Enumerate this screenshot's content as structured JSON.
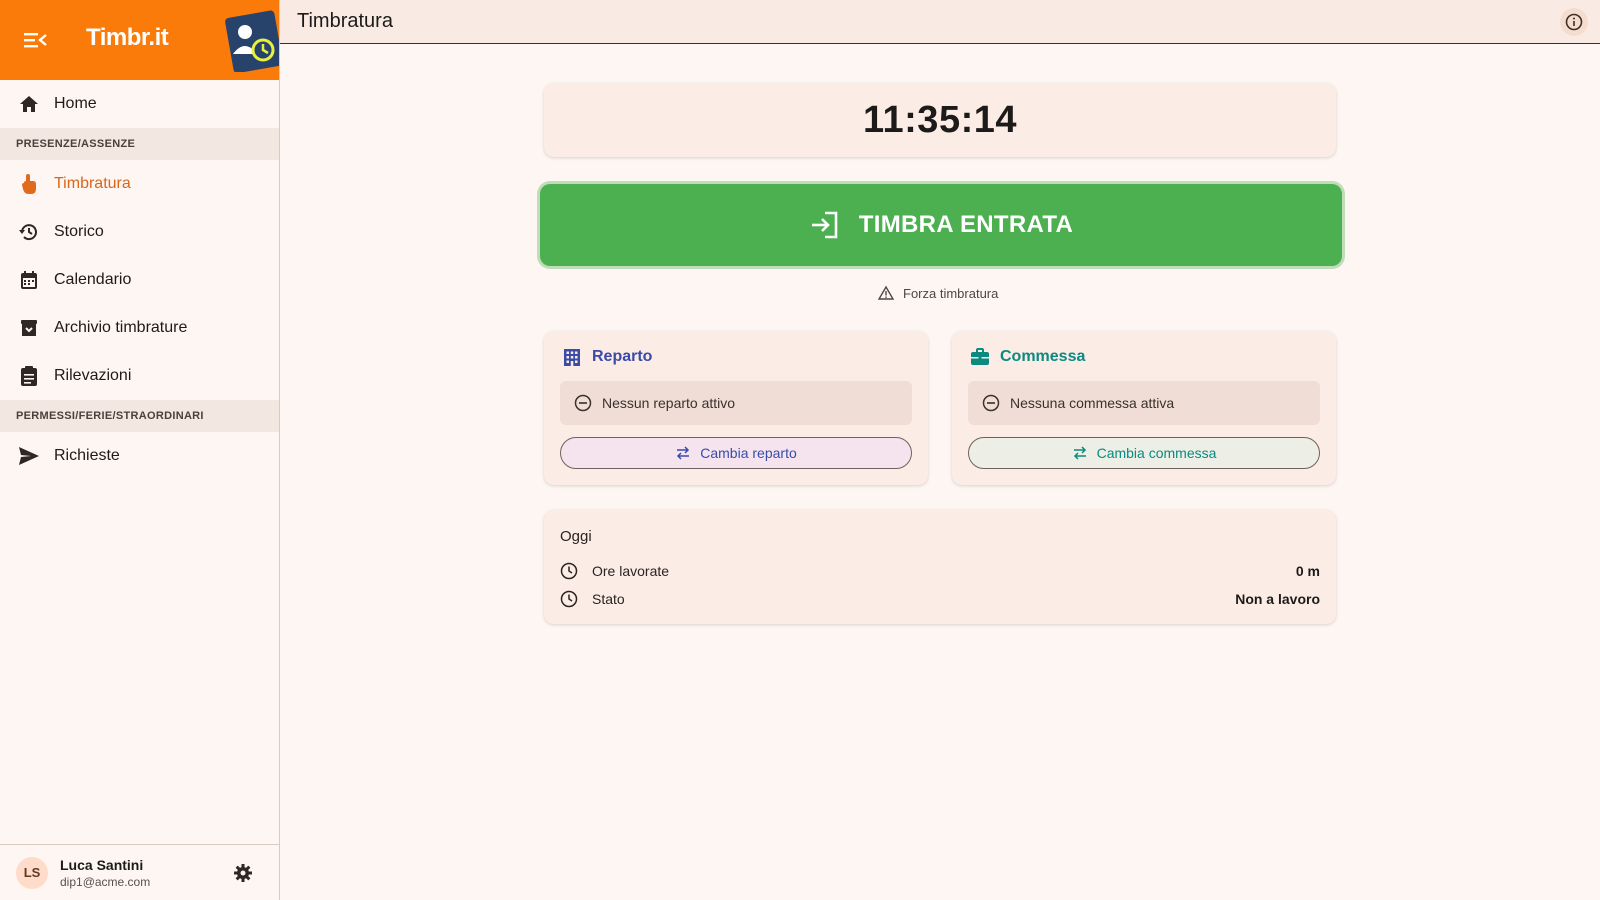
{
  "app": {
    "brand": "Timbr.it"
  },
  "sidebar": {
    "items": [
      {
        "label": "Home",
        "icon": "home-icon"
      },
      {
        "label": "Timbratura",
        "icon": "touch-icon",
        "active": true
      },
      {
        "label": "Storico",
        "icon": "history-icon"
      },
      {
        "label": "Calendario",
        "icon": "calendar-icon"
      },
      {
        "label": "Archivio timbrature",
        "icon": "archive-icon"
      },
      {
        "label": "Rilevazioni",
        "icon": "clipboard-icon"
      },
      {
        "label": "Richieste",
        "icon": "send-icon"
      }
    ],
    "sections": [
      "PRESENZE/ASSENZE",
      "PERMESSI/FERIE/STRAORDINARI"
    ]
  },
  "user": {
    "initials": "LS",
    "name": "Luca Santini",
    "email": "dip1@acme.com"
  },
  "header": {
    "title": "Timbratura"
  },
  "main": {
    "clock": "11:35:14",
    "punch_label": "TIMBRA ENTRATA",
    "force_label": "Forza timbratura",
    "reparto": {
      "title": "Reparto",
      "status": "Nessun reparto attivo",
      "button": "Cambia reparto"
    },
    "commessa": {
      "title": "Commessa",
      "status": "Nessuna commessa attiva",
      "button": "Cambia commessa"
    },
    "today": {
      "title": "Oggi",
      "rows": [
        {
          "label": "Ore lavorate",
          "value": "0 m"
        },
        {
          "label": "Stato",
          "value": "Non a lavoro"
        }
      ]
    }
  },
  "colors": {
    "accent": "#fa7a0a",
    "success": "#4caf50",
    "blue": "#3a4ba8",
    "teal": "#0b8a80",
    "active_text": "#d9661a"
  }
}
